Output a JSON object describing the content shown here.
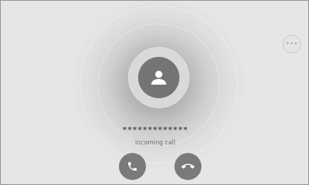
{
  "caller": {
    "number_masked": "*************",
    "status": "Incoming call"
  },
  "icons": {
    "avatar": "person-icon",
    "more": "more-options-icon",
    "accept": "phone-icon",
    "decline": "hang-up-icon"
  },
  "more_label": "•••",
  "colors": {
    "background": "#e6e6e6",
    "button": "#7a7a7a",
    "avatar": "#747474"
  }
}
